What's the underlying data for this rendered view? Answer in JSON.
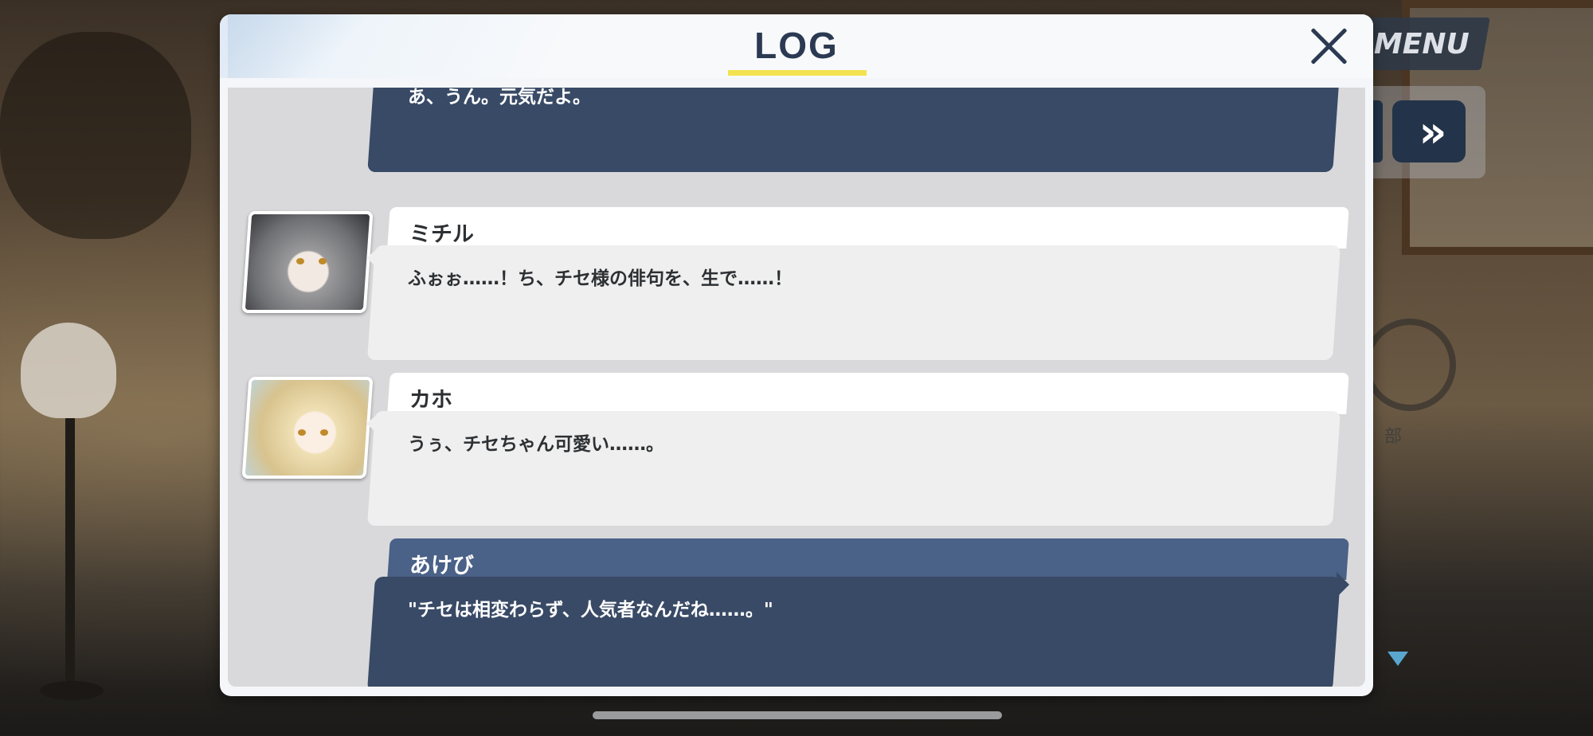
{
  "header": {
    "title": "LOG"
  },
  "controls": {
    "menu_label": "MENU",
    "fast_forward_glyph": "»"
  },
  "background": {
    "emblem_text": "部"
  },
  "entries": [
    {
      "speaker": "",
      "text": "あ、うん。元気だよ。",
      "style": "dark"
    },
    {
      "speaker": "ミチル",
      "text": "ふぉぉ……！ち、チセ様の俳句を、生で……！",
      "style": "light"
    },
    {
      "speaker": "カホ",
      "text": "うぅ、チセちゃん可愛い……。",
      "style": "light"
    },
    {
      "speaker": "あけび",
      "text": "\"チセは相変わらず、人気者なんだね……。\"",
      "style": "dark"
    }
  ],
  "colors": {
    "panel": "#f4f6f9",
    "title": "#2b3a52",
    "title_underline": "#f3e24f",
    "bubble_dark": "#394a66",
    "name_dark": "#4a6188",
    "bubble_light": "#efefef"
  }
}
